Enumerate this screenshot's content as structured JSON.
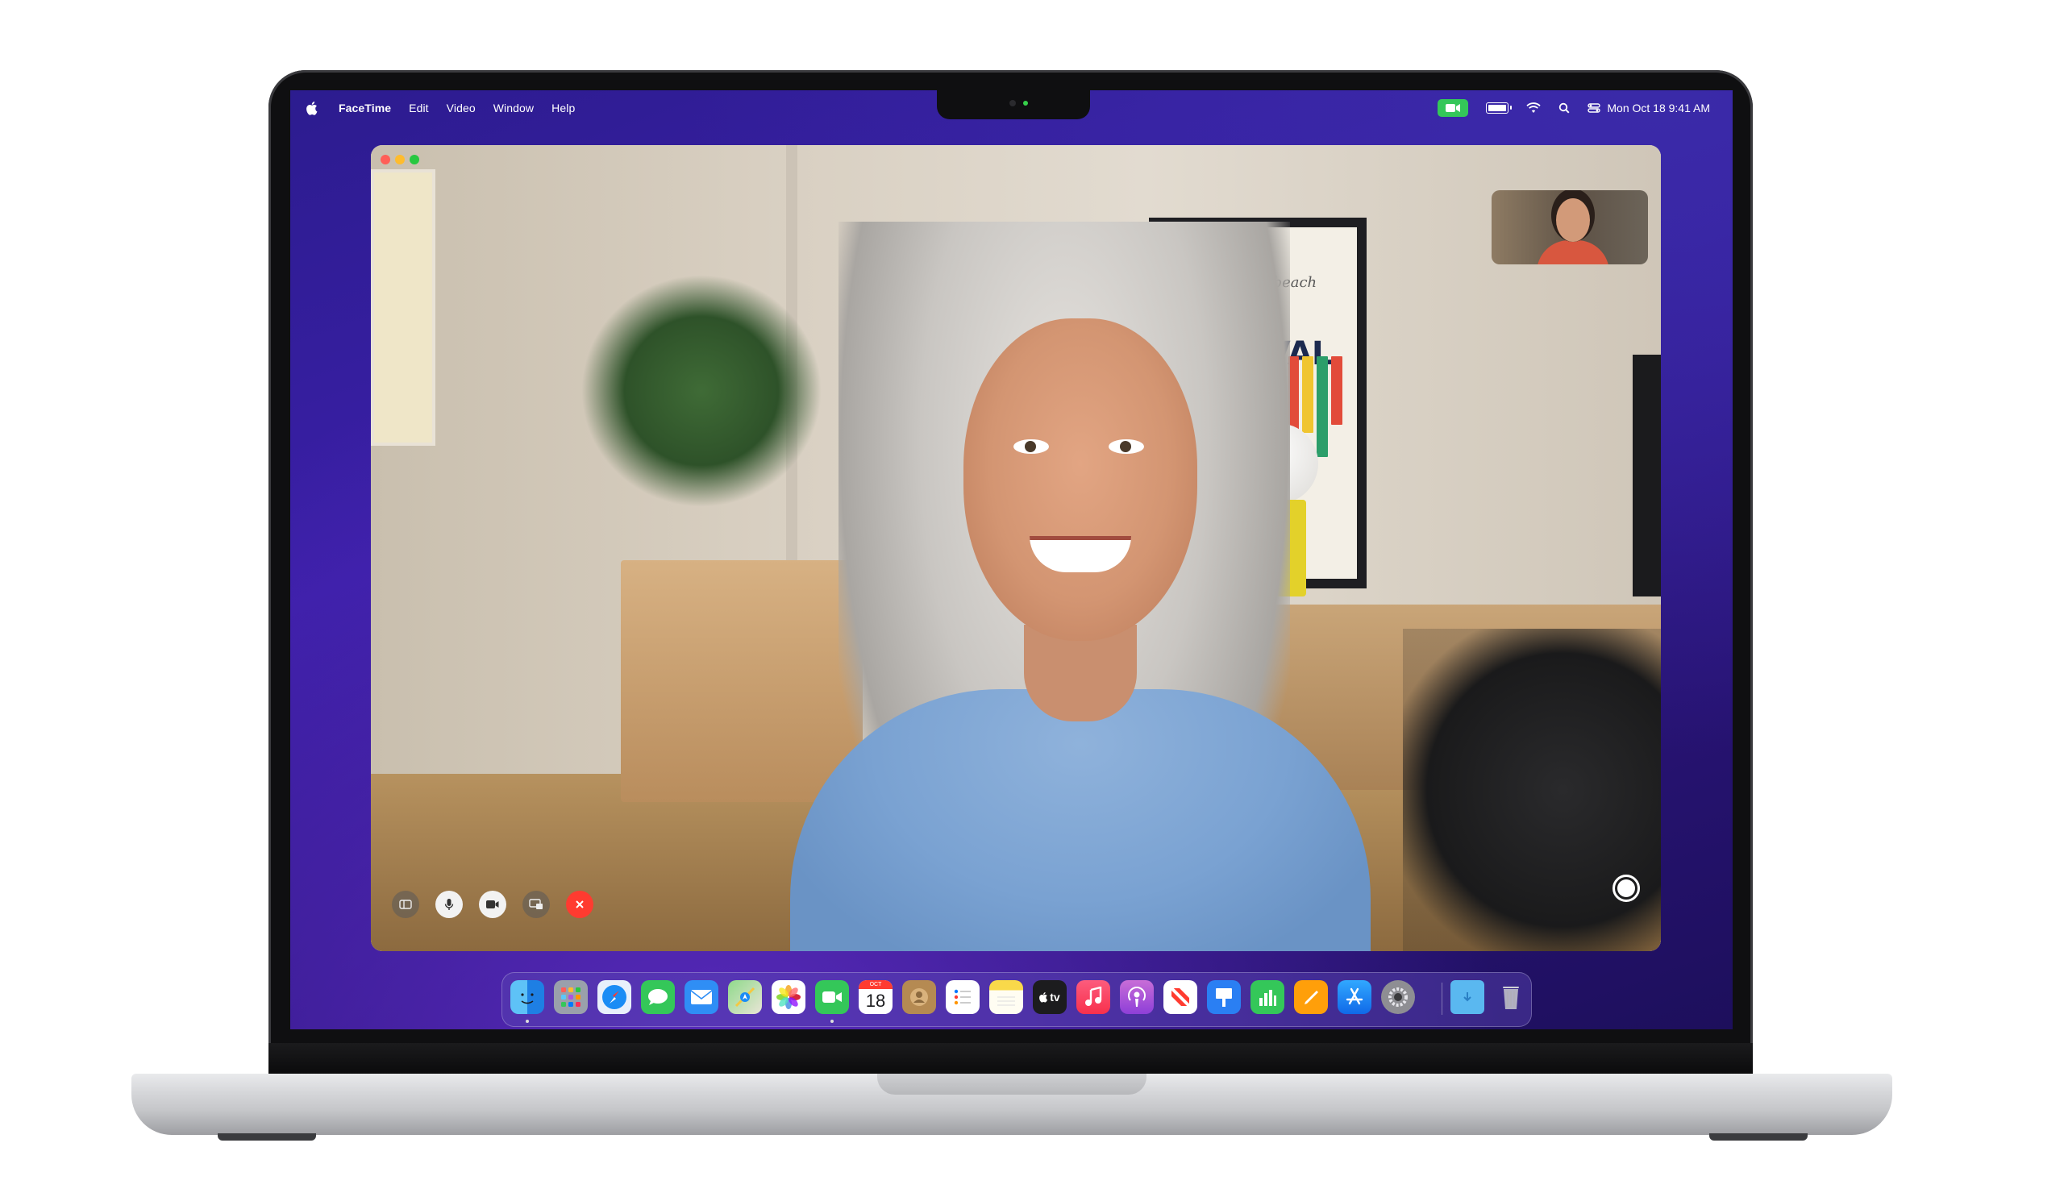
{
  "menubar": {
    "app_name": "FaceTime",
    "menus": [
      "Edit",
      "Video",
      "Window",
      "Help"
    ],
    "date_time": "Mon Oct 18  9:41 AM"
  },
  "poster": {
    "subtitle": "newport beach",
    "title": "JAZZ FESTIVAL"
  },
  "call_controls": {
    "items": [
      "sidebar-toggle",
      "microphone",
      "video-camera",
      "screen-share",
      "end-call"
    ]
  },
  "dock": {
    "calendar_month": "OCT",
    "calendar_day": "18",
    "tv_label": "tv",
    "apps": [
      "Finder",
      "Launchpad",
      "Safari",
      "Messages",
      "Mail",
      "Maps",
      "Photos",
      "FaceTime",
      "Calendar",
      "Contacts",
      "Reminders",
      "Notes",
      "TV",
      "Music",
      "Podcasts",
      "News",
      "Keynote",
      "Numbers",
      "Pages",
      "App Store",
      "System Preferences",
      "Downloads",
      "Trash"
    ]
  },
  "colors": {
    "accent_green": "#34c759",
    "end_call_red": "#ff3b30",
    "wallpaper_purple": "#3b1fa8"
  }
}
